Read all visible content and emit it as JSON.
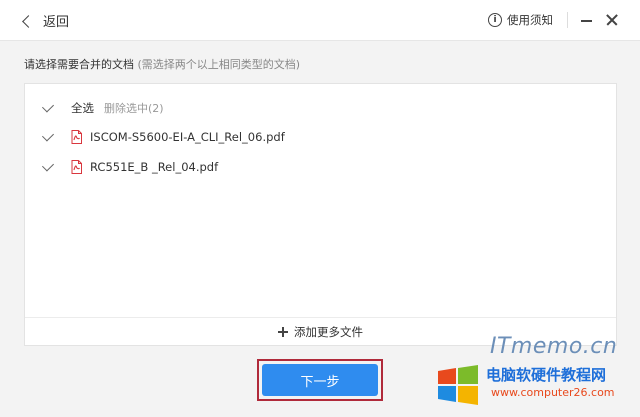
{
  "header": {
    "back_label": "返回",
    "help_label": "使用须知"
  },
  "main": {
    "prompt": "请选择需要合并的文档",
    "prompt_hint": "(需选择两个以上相同类型的文档)",
    "select_all_label": "全选",
    "delete_selected_label": "删除选中(2)",
    "files": [
      {
        "name": "ISCOM-S5600-EI-A_CLI_Rel_06.pdf",
        "checked": true
      },
      {
        "name": "RC551E_B _Rel_04.pdf",
        "checked": true
      }
    ],
    "add_more_label": "添加更多文件",
    "next_label": "下一步"
  },
  "watermark": {
    "brand": "ITmemo.cn",
    "site_cn": "电脑软硬件教程网",
    "site_url": "www.computer26.com"
  },
  "colors": {
    "accent": "#2f8cef",
    "highlight_border": "#b02a3a",
    "pdf_icon": "#d9363e"
  }
}
